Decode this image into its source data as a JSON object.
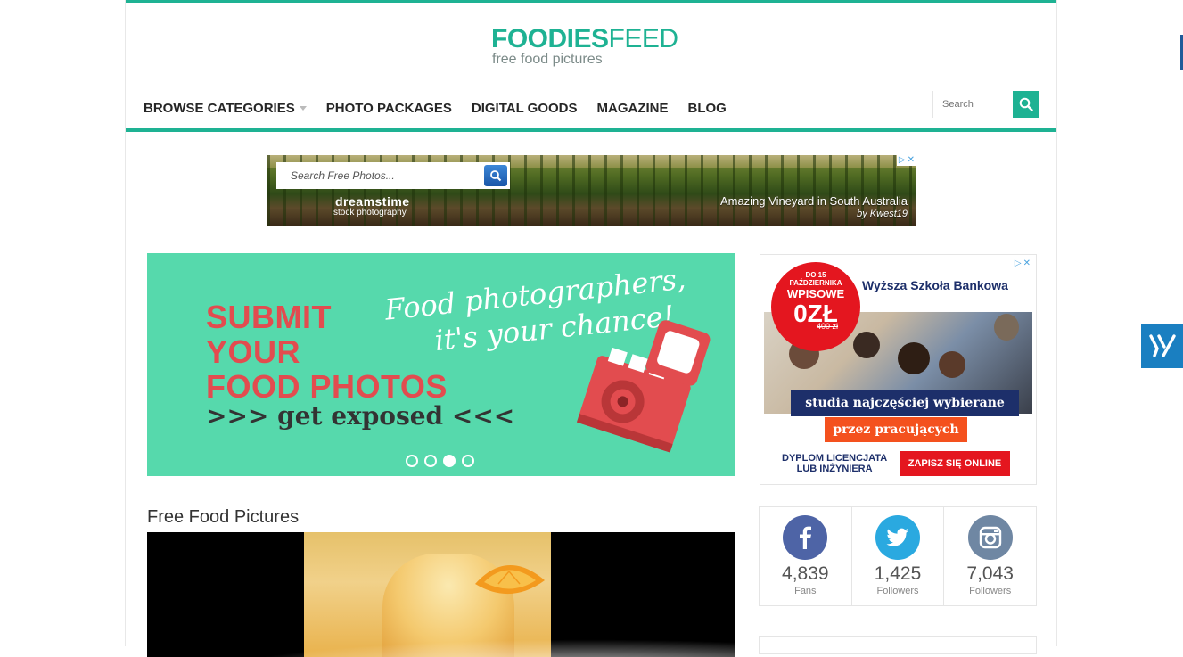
{
  "header": {
    "logo_bold": "FOODIES",
    "logo_thin": "FEED",
    "tagline": "free food pictures"
  },
  "nav": {
    "items": [
      {
        "label": "BROWSE CATEGORIES",
        "has_dropdown": true
      },
      {
        "label": "PHOTO PACKAGES"
      },
      {
        "label": "DIGITAL GOODS"
      },
      {
        "label": "MAGAZINE"
      },
      {
        "label": "BLOG"
      }
    ],
    "search_placeholder": "Search"
  },
  "ad_banner": {
    "search_placeholder": "Search Free Photos...",
    "brand": "dreamstime",
    "brand_sub": "stock photography",
    "caption": "Amazing Vineyard in South Australia",
    "caption_by": "by Kwest19"
  },
  "slider": {
    "headline": [
      "SUBMIT",
      "YOUR",
      "FOOD PHOTOS"
    ],
    "subline": ">>> get exposed <<<",
    "script_line1": "Food photographers,",
    "script_line2": "it's your chance!",
    "active_slide": 3,
    "slide_count": 4
  },
  "side_ad": {
    "badge_top": "DO 15",
    "badge_mid": "PAŹDZIERNIKA",
    "badge_wpisowe": "WPISOWE",
    "badge_price": "0ZŁ",
    "badge_old": "400 zł",
    "school": "Wyższa Szkoła Bankowa",
    "band1": "studia najczęściej wybierane",
    "band2": "przez pracujących",
    "dyplom_line1": "DYPLOM LICENCJATA",
    "dyplom_line2": "LUB INŻYNIERA",
    "cta": "ZAPISZ SIĘ ONLINE"
  },
  "section": {
    "title": "Free Food Pictures"
  },
  "social": [
    {
      "network": "facebook",
      "count": "4,839",
      "label": "Fans",
      "color": "#4e64a6"
    },
    {
      "network": "twitter",
      "count": "1,425",
      "label": "Followers",
      "color": "#2aa9e0"
    },
    {
      "network": "instagram",
      "count": "7,043",
      "label": "Followers",
      "color": "#6f87a3"
    }
  ],
  "colors": {
    "brand": "#1eb293",
    "slider_bg": "#56d9ac",
    "slider_headline": "#e24c4f"
  }
}
